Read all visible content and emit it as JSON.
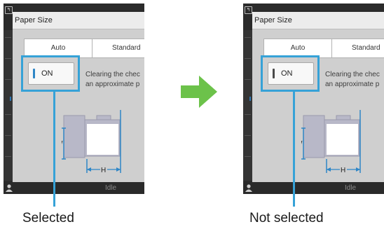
{
  "panels": [
    {
      "dialog_title": "Paper Size",
      "tabs": [
        "Auto",
        "Standard"
      ],
      "toggle_label": "ON",
      "toggle_state": "selected",
      "description_lines": [
        "Clearing the chec",
        "an approximate p"
      ],
      "diagram_labels": {
        "width": "W",
        "height": "H"
      },
      "status": "Idle",
      "caption": "Selected"
    },
    {
      "dialog_title": "Paper Size",
      "tabs": [
        "Auto",
        "Standard"
      ],
      "toggle_label": "ON",
      "toggle_state": "not selected",
      "description_lines": [
        "Clearing the chec",
        "an approximate p"
      ],
      "diagram_labels": {
        "width": "W",
        "height": "H"
      },
      "status": "Idle",
      "caption": "Not selected"
    }
  ],
  "icons": {
    "transition_arrow": "arrow-right-icon",
    "user": "user-icon"
  },
  "colors": {
    "highlight": "#36a2d7",
    "toggle_on_indicator": "#2e86c6",
    "toggle_off_indicator": "#4a4a4a",
    "arrow": "#6cc24a"
  }
}
